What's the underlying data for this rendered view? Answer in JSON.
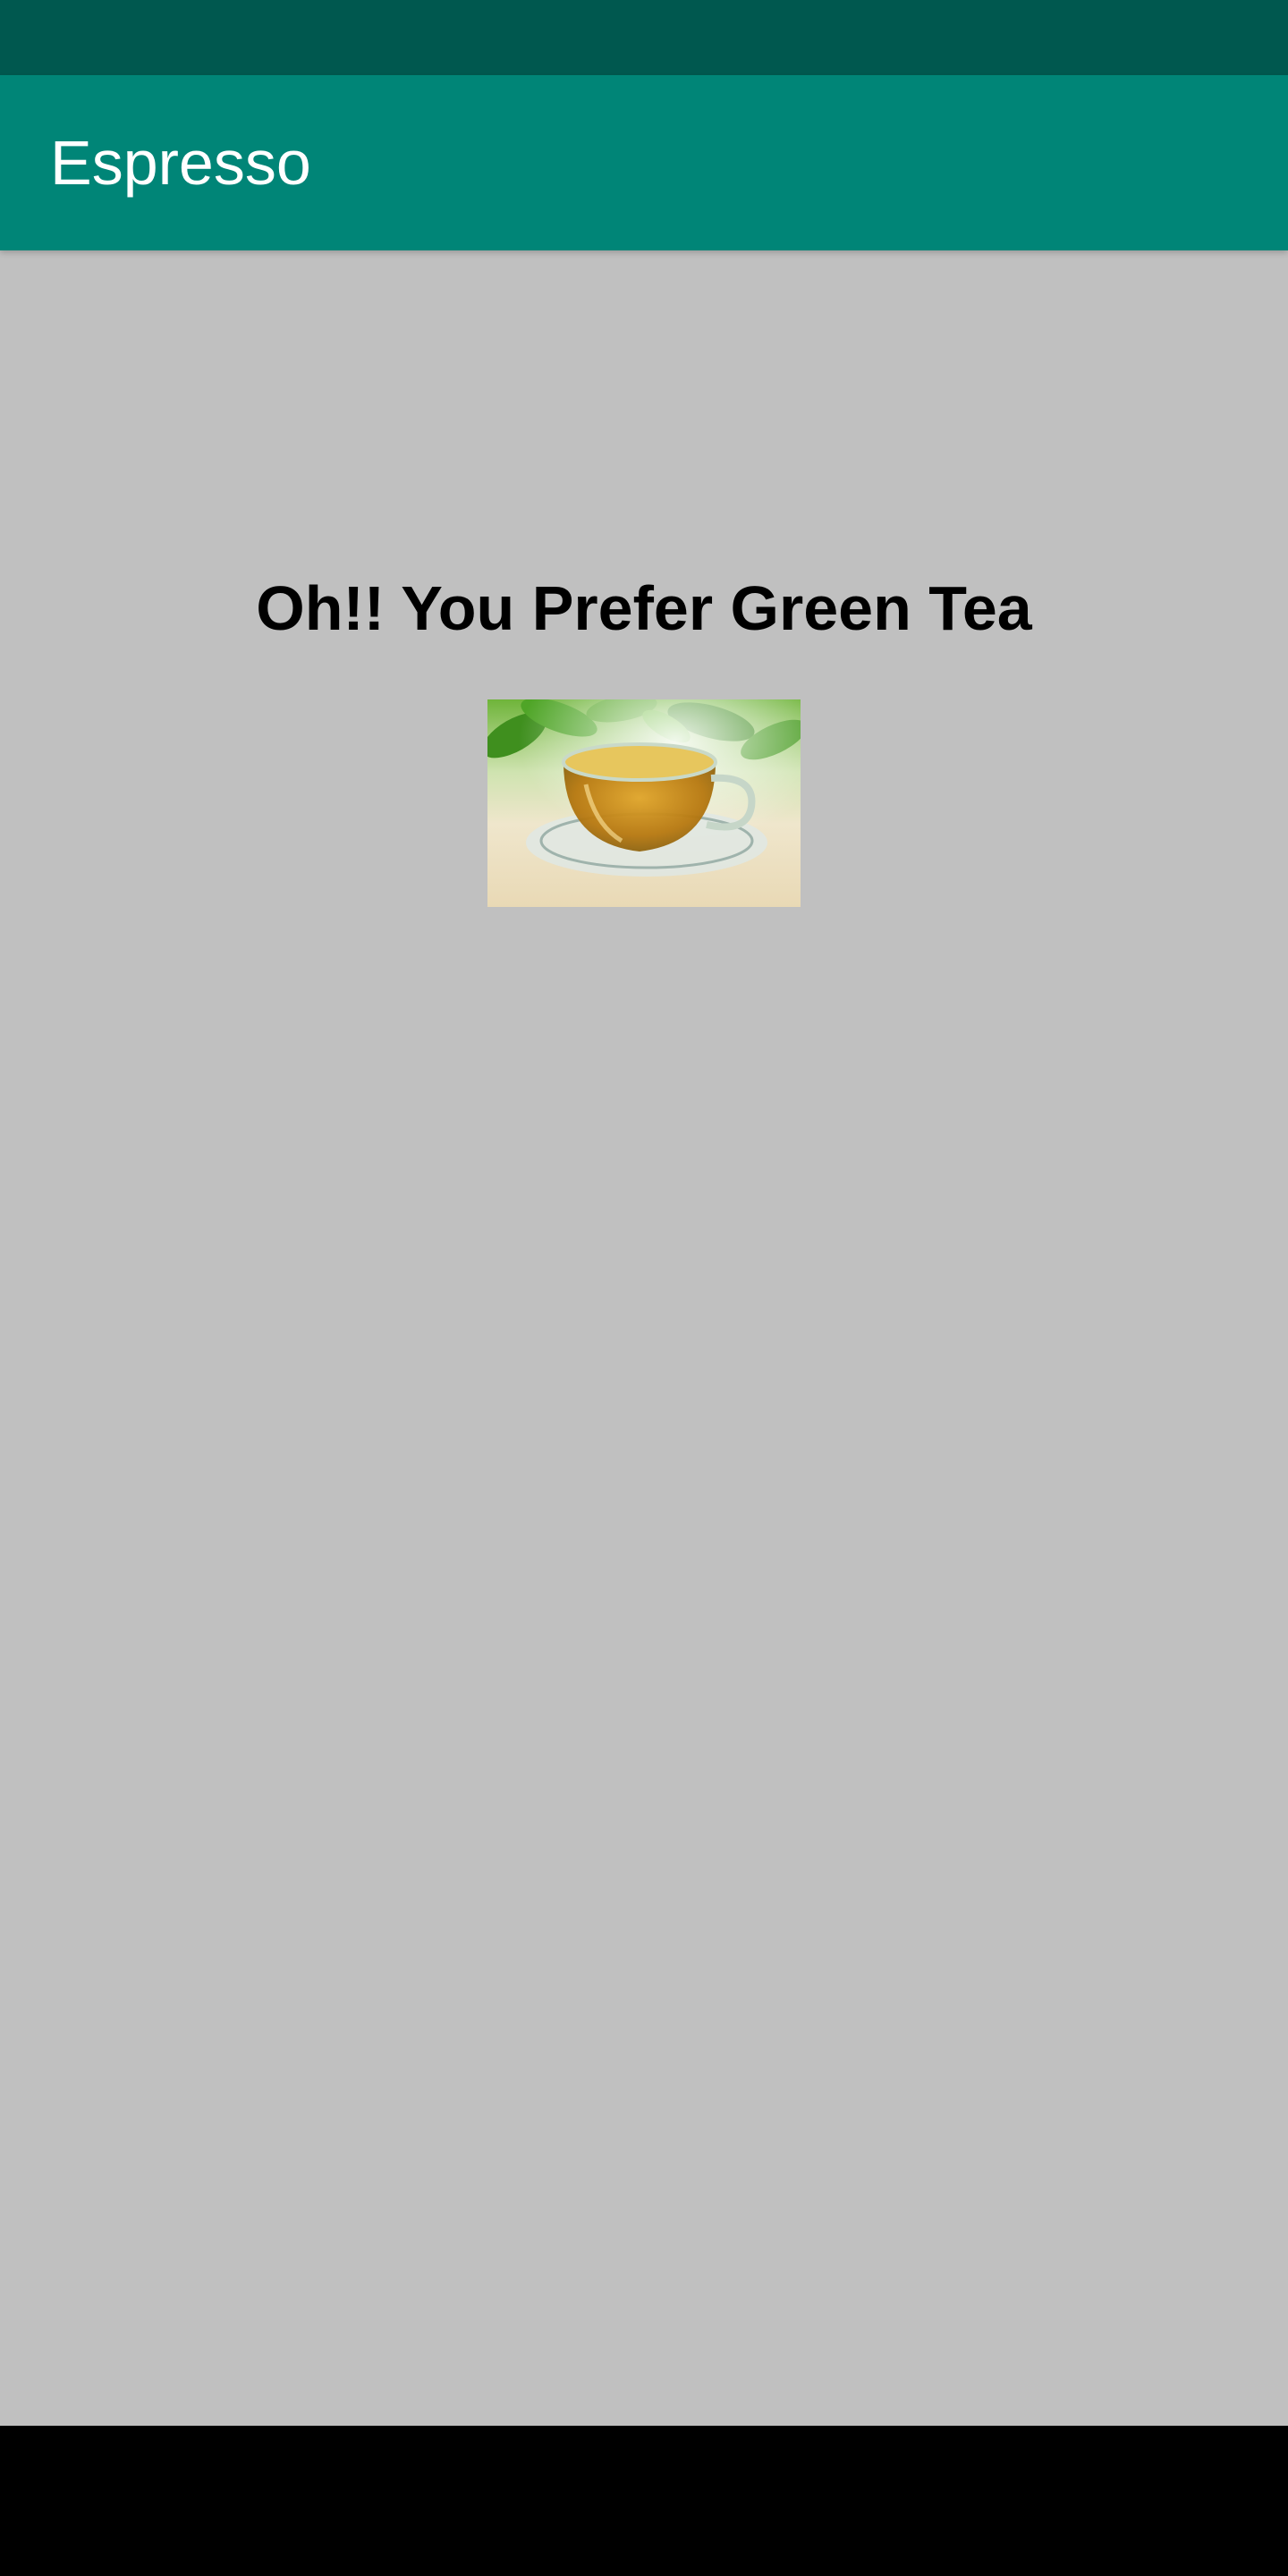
{
  "app_bar": {
    "title": "Espresso",
    "color": "#008577"
  },
  "status_bar": {
    "color": "#00584f"
  },
  "main": {
    "headline": "Oh!! You Prefer Green Tea",
    "image_subject": "cup of green tea on saucer with green leaves",
    "background_color": "#c0c0c0"
  },
  "nav_bar": {
    "color": "#000000"
  }
}
